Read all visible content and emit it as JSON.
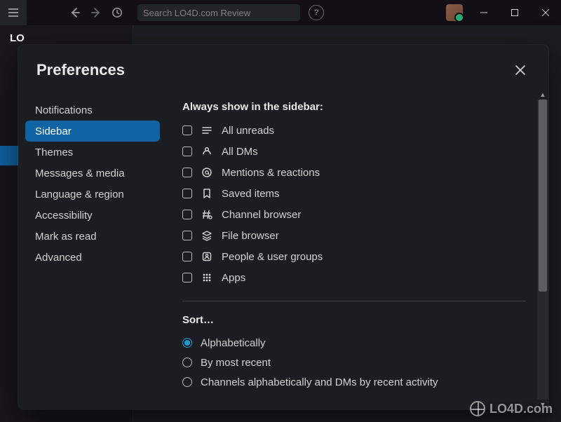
{
  "titlebar": {
    "search_placeholder": "Search LO4D.com Review"
  },
  "workspace_label": "LO",
  "modal": {
    "title": "Preferences",
    "nav": [
      "Notifications",
      "Sidebar",
      "Themes",
      "Messages & media",
      "Language & region",
      "Accessibility",
      "Mark as read",
      "Advanced"
    ],
    "active_nav_index": 1,
    "section1_title": "Always show in the sidebar:",
    "checks": [
      {
        "label": "All unreads"
      },
      {
        "label": "All DMs"
      },
      {
        "label": "Mentions & reactions"
      },
      {
        "label": "Saved items"
      },
      {
        "label": "Channel browser"
      },
      {
        "label": "File browser"
      },
      {
        "label": "People & user groups"
      },
      {
        "label": "Apps"
      }
    ],
    "section2_title": "Sort…",
    "radios": [
      {
        "label": "Alphabetically",
        "checked": true
      },
      {
        "label": "By most recent",
        "checked": false
      },
      {
        "label": "Channels alphabetically and DMs by recent activity",
        "checked": false
      }
    ]
  },
  "watermark": "LO4D.com"
}
